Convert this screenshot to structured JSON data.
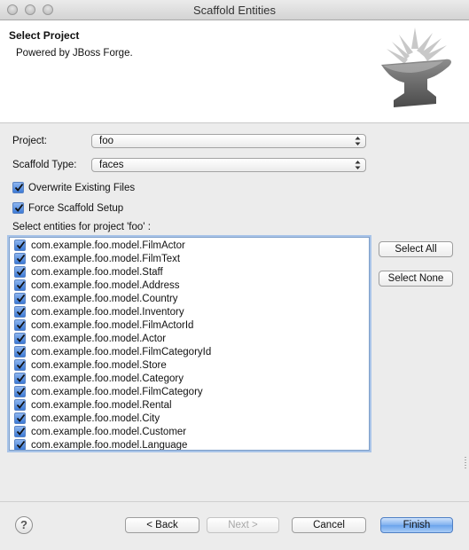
{
  "window": {
    "title": "Scaffold Entities"
  },
  "banner": {
    "title": "Select Project",
    "description": "Powered by JBoss Forge."
  },
  "form": {
    "project_label": "Project:",
    "project_value": "foo",
    "scaffold_type_label": "Scaffold Type:",
    "scaffold_type_value": "faces",
    "overwrite_label": "Overwrite Existing Files",
    "overwrite_checked": true,
    "force_setup_label": "Force Scaffold Setup",
    "force_setup_checked": true,
    "entities_label": "Select entities for project 'foo' :"
  },
  "entities": [
    "com.example.foo.model.FilmActor",
    "com.example.foo.model.FilmText",
    "com.example.foo.model.Staff",
    "com.example.foo.model.Address",
    "com.example.foo.model.Country",
    "com.example.foo.model.Inventory",
    "com.example.foo.model.FilmActorId",
    "com.example.foo.model.Actor",
    "com.example.foo.model.FilmCategoryId",
    "com.example.foo.model.Store",
    "com.example.foo.model.Category",
    "com.example.foo.model.FilmCategory",
    "com.example.foo.model.Rental",
    "com.example.foo.model.City",
    "com.example.foo.model.Customer",
    "com.example.foo.model.Language"
  ],
  "buttons": {
    "select_all": "Select All",
    "select_none": "Select None",
    "back": "< Back",
    "next": "Next >",
    "cancel": "Cancel",
    "finish": "Finish",
    "help": "?"
  },
  "colors": {
    "accent": "#3c7ad6",
    "default_button": "#7fb0ef"
  }
}
